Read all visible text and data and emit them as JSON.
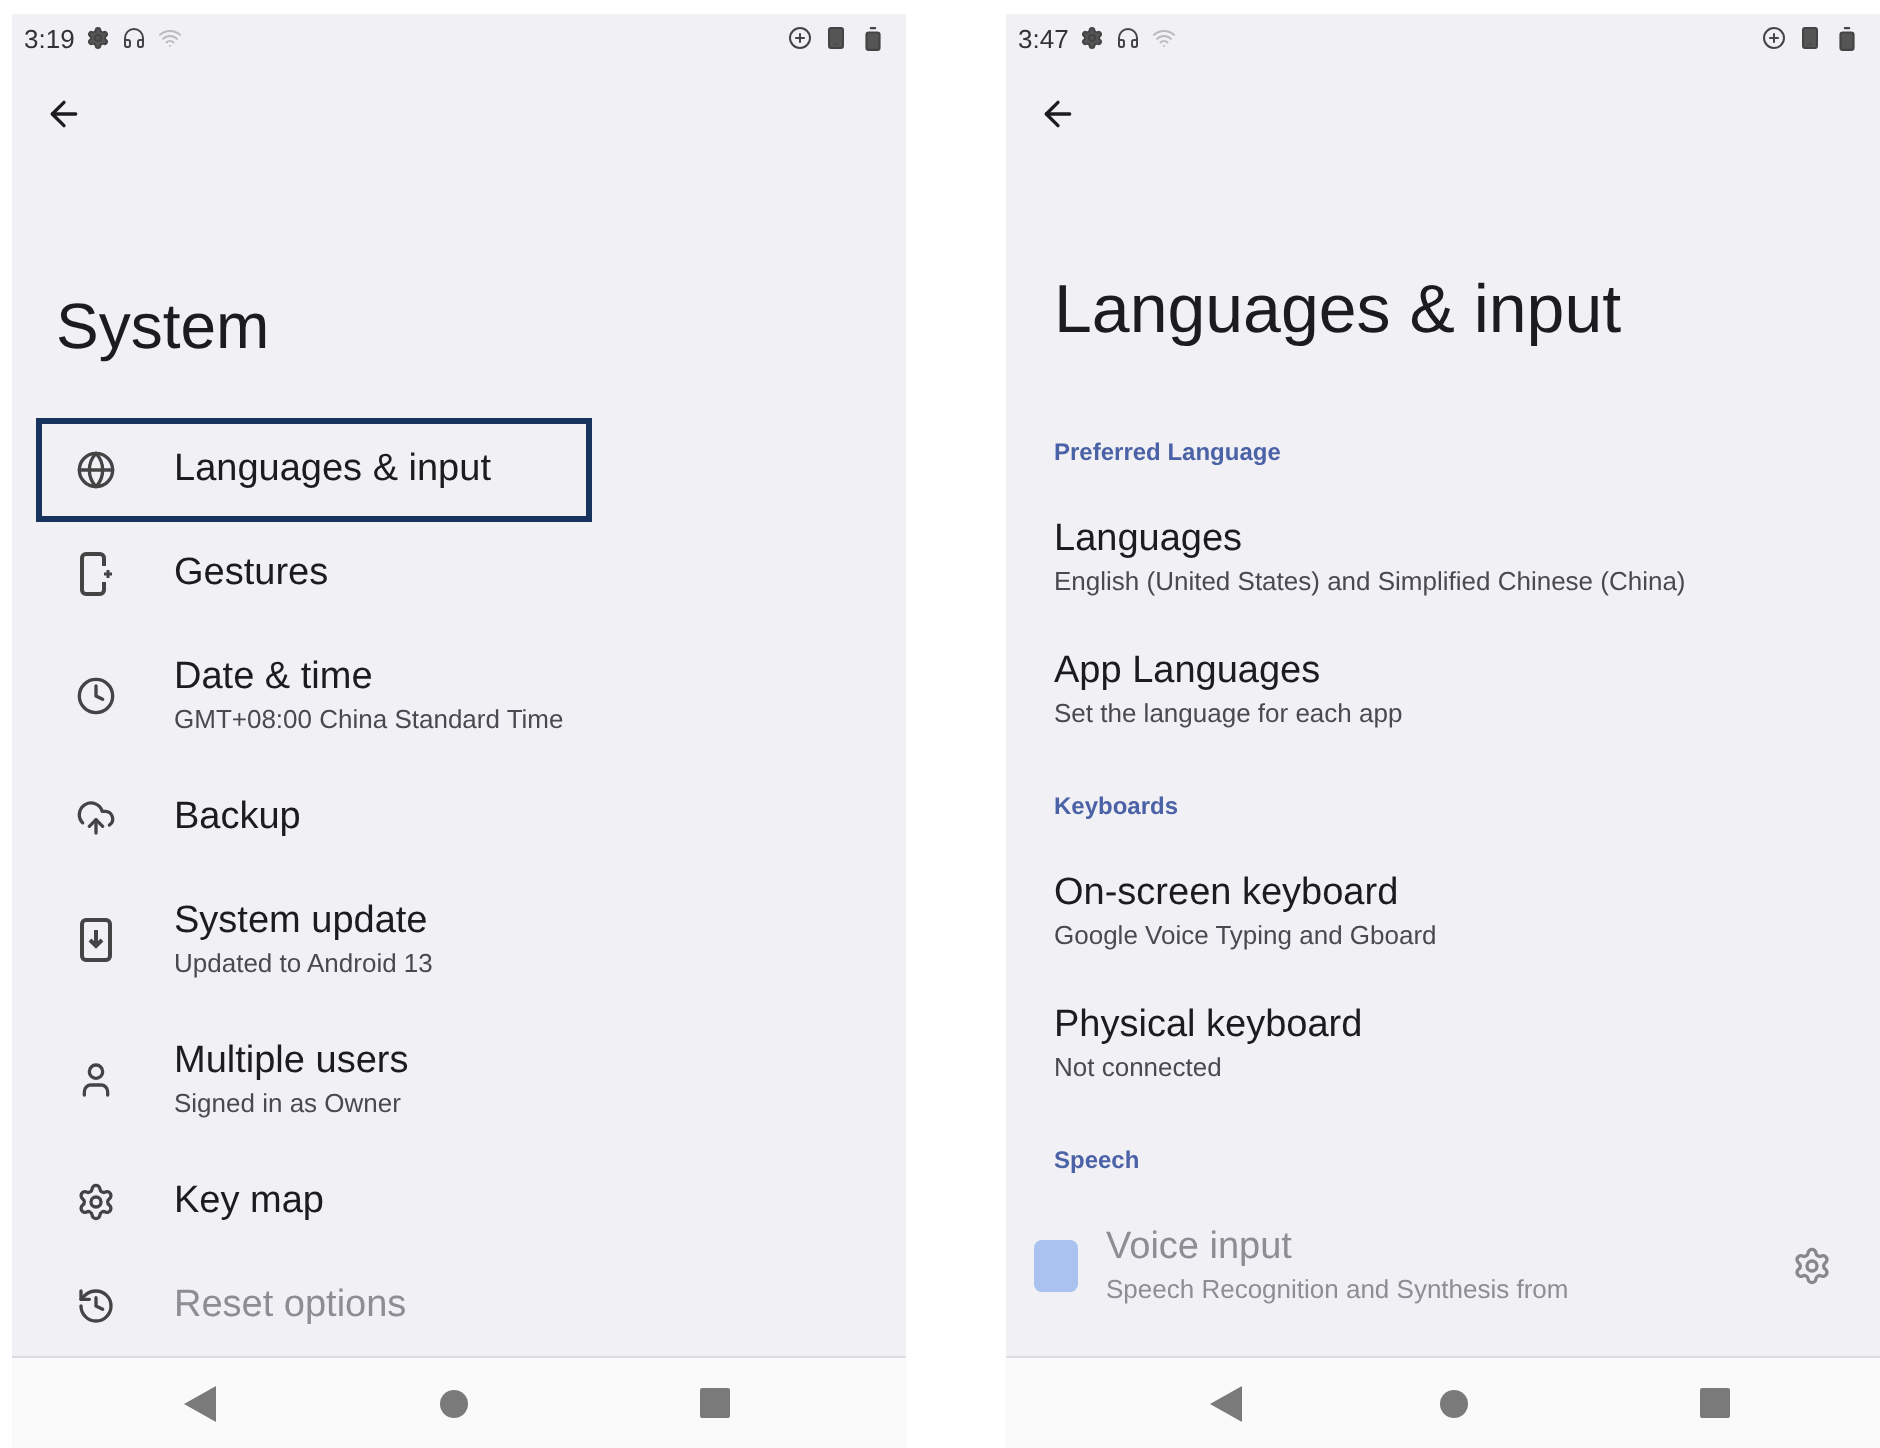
{
  "screens": [
    {
      "status_bar": {
        "time": "3:19"
      },
      "title": "System",
      "items": [
        {
          "title": "Languages & input",
          "highlighted": true
        },
        {
          "title": "Gestures",
          "highlighted": false
        },
        {
          "title": "Date & time",
          "subtitle": "GMT+08:00 China Standard Time",
          "highlighted": false
        },
        {
          "title": "Backup",
          "highlighted": false
        },
        {
          "title": "System update",
          "subtitle": "Updated to Android 13",
          "highlighted": false
        },
        {
          "title": "Multiple users",
          "subtitle": "Signed in as Owner",
          "highlighted": false
        },
        {
          "title": "Key map",
          "highlighted": false
        },
        {
          "title": "Reset options",
          "highlighted": false
        }
      ]
    },
    {
      "status_bar": {
        "time": "3:47"
      },
      "title": "Languages & input",
      "sections": [
        {
          "header": "Preferred Language",
          "items": [
            {
              "title": "Languages",
              "subtitle": "English (United States) and Simplified Chinese (China)"
            },
            {
              "title": "App Languages",
              "subtitle": "Set the language for each app"
            }
          ]
        },
        {
          "header": "Keyboards",
          "items": [
            {
              "title": "On-screen keyboard",
              "subtitle": "Google Voice Typing and Gboard"
            },
            {
              "title": "Physical keyboard",
              "subtitle": "Not connected"
            }
          ]
        },
        {
          "header": "Speech",
          "items": [
            {
              "title": "Voice input",
              "subtitle": "Speech Recognition and Synthesis from",
              "kind": "app"
            }
          ]
        }
      ]
    }
  ]
}
